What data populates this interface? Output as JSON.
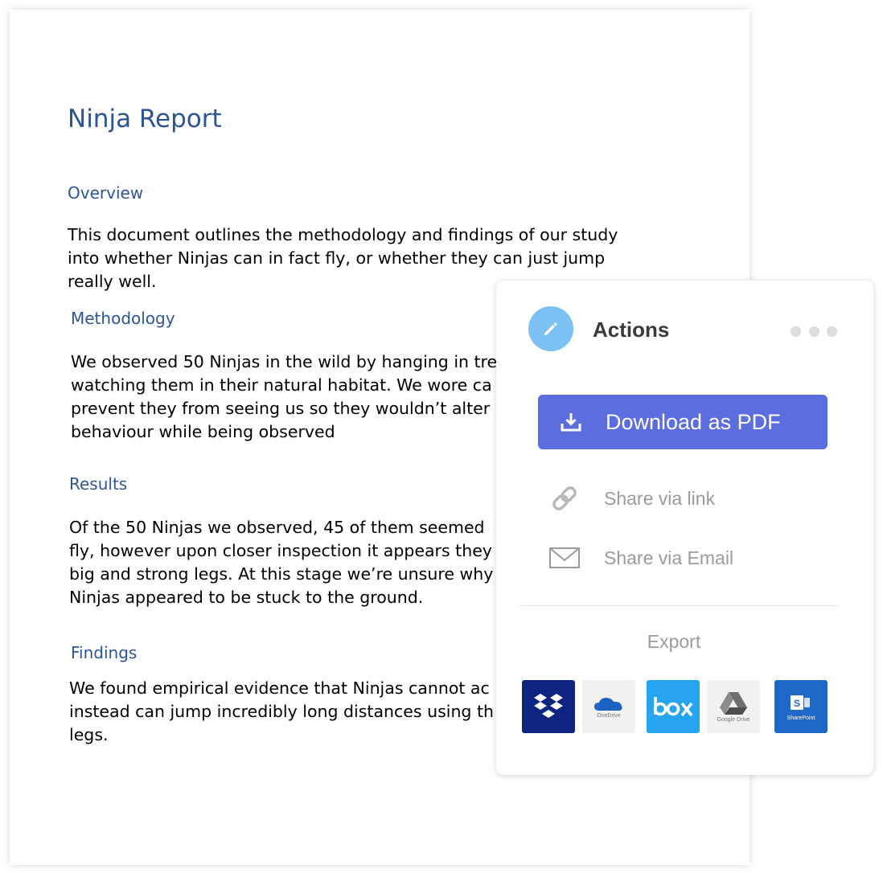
{
  "document": {
    "title": "Ninja Report",
    "sections": [
      {
        "heading": "Overview",
        "body": "This document outlines the methodology and findings of our study\ninto whether Ninjas can in fact fly, or whether they can just jump\nreally well."
      },
      {
        "heading": "Methodology",
        "body": "We observed 50 Ninjas in the wild by hanging in tre\nwatching them in their natural habitat. We wore ca\nprevent they from seeing us so they wouldn’t alter\nbehaviour while being observed"
      },
      {
        "heading": "Results",
        "body": "Of the 50 Ninjas we observed, 45 of them seemed\nfly, however upon closer inspection it appears they\nbig and strong legs. At this stage we’re unsure why\nNinjas appeared to be stuck to the ground."
      },
      {
        "heading": "Findings",
        "body": "We found empirical evidence that Ninjas cannot ac\ninstead can jump incredibly long distances using th\nlegs."
      }
    ]
  },
  "actions": {
    "title": "Actions",
    "download_label": "Download as PDF",
    "share_link_label": "Share via link",
    "share_email_label": "Share via Email",
    "export_label": "Export",
    "services": [
      {
        "name": "Dropbox",
        "caption": "",
        "icon": "dropbox-icon",
        "color": "#0d2481"
      },
      {
        "name": "OneDrive",
        "caption": "OneDrive",
        "icon": "onedrive-icon",
        "color": "#f1f1f1"
      },
      {
        "name": "Box",
        "caption": "",
        "icon": "box-icon",
        "color": "#27a4ef"
      },
      {
        "name": "Google Drive",
        "caption": "Google Drive",
        "icon": "google-drive-icon",
        "color": "#f1f1f1"
      },
      {
        "name": "SharePoint",
        "caption": "SharePoint",
        "icon": "sharepoint-icon",
        "color": "#1e68c9"
      }
    ]
  },
  "colors": {
    "heading": "#2e5496",
    "accent_button": "#5c6de0",
    "icon_circle": "#7cc1f4",
    "muted_text": "#9b9b9b"
  }
}
